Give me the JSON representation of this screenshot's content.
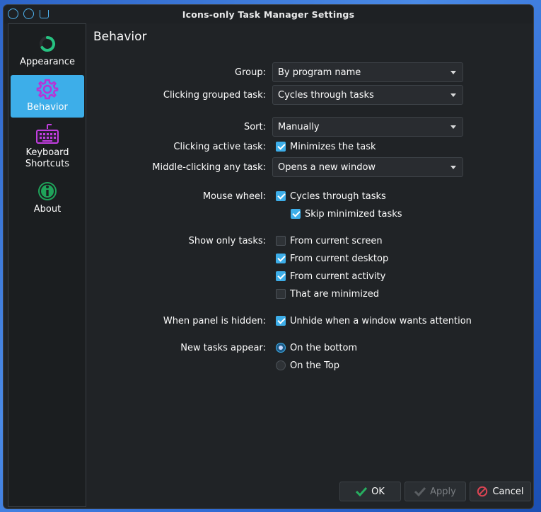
{
  "window": {
    "title": "Icons-only Task Manager Settings"
  },
  "sidebar": {
    "items": [
      {
        "label": "Appearance",
        "icon": "appearance-icon",
        "active": false
      },
      {
        "label": "Behavior",
        "icon": "gear-icon",
        "active": true
      },
      {
        "label": "Keyboard Shortcuts",
        "line1": "Keyboard",
        "line2": "Shortcuts",
        "icon": "keyboard-icon",
        "active": false
      },
      {
        "label": "About",
        "icon": "info-icon",
        "active": false
      }
    ]
  },
  "page": {
    "title": "Behavior",
    "group": {
      "label": "Group:",
      "value": "By program name"
    },
    "clicking_grouped": {
      "label": "Clicking grouped task:",
      "value": "Cycles through tasks"
    },
    "sort": {
      "label": "Sort:",
      "value": "Manually"
    },
    "clicking_active": {
      "label": "Clicking active task:",
      "option": "Minimizes the task",
      "checked": true
    },
    "middle_click": {
      "label": "Middle-clicking any task:",
      "value": "Opens a new window"
    },
    "mouse_wheel": {
      "label": "Mouse wheel:",
      "cycle": {
        "text": "Cycles through tasks",
        "checked": true
      },
      "skip": {
        "text": "Skip minimized tasks",
        "checked": true
      }
    },
    "show_only": {
      "label": "Show only tasks:",
      "options": [
        {
          "text": "From current screen",
          "checked": false
        },
        {
          "text": "From current desktop",
          "checked": true
        },
        {
          "text": "From current activity",
          "checked": true
        },
        {
          "text": "That are minimized",
          "checked": false
        }
      ]
    },
    "panel_hidden": {
      "label": "When panel is hidden:",
      "option": "Unhide when a window wants attention",
      "checked": true
    },
    "new_tasks": {
      "label": "New tasks appear:",
      "options": [
        {
          "text": "On the bottom",
          "selected": true
        },
        {
          "text": "On the Top",
          "selected": false
        }
      ]
    }
  },
  "buttons": {
    "ok": "OK",
    "apply": "Apply",
    "cancel": "Cancel"
  },
  "colors": {
    "accent": "#3daee9",
    "window_bg": "#202326",
    "cancel_red": "#da4453",
    "ok_green": "#27ae60"
  }
}
